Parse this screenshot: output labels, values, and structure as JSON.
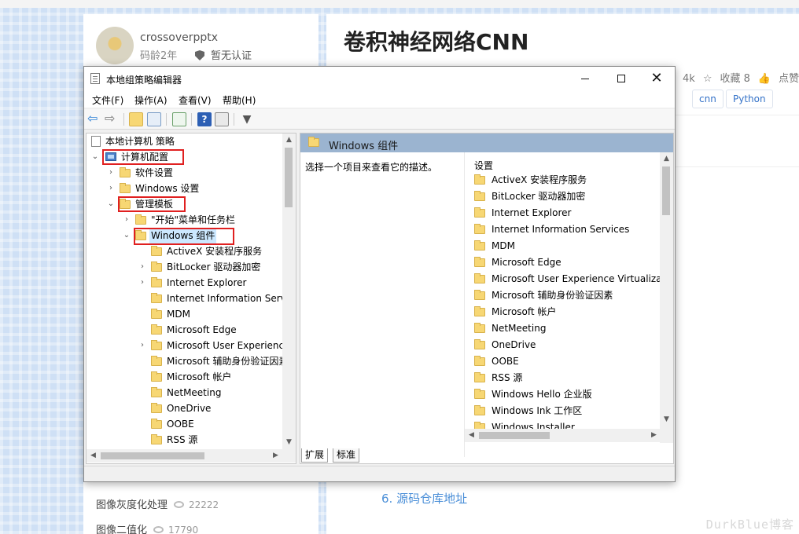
{
  "blog": {
    "author_name": "crossoverpptx",
    "author_age": "码龄2年",
    "author_cert": "暂无认证",
    "article_title": "卷积神经网络CNN",
    "stats": [
      "4k",
      "收藏 8",
      "点赞数"
    ],
    "tags": [
      "cnn",
      "Python"
    ],
    "related": [
      {
        "title": "图像灰度化处理",
        "count": "22222"
      },
      {
        "title": "图像二值化",
        "count": "17790"
      }
    ],
    "toc_link": "6. 源码仓库地址",
    "watermark": "DurkBlue博客"
  },
  "window": {
    "title": "本地组策略编辑器",
    "menu": [
      "文件(F)",
      "操作(A)",
      "查看(V)",
      "帮助(H)"
    ],
    "tree": {
      "root": "本地计算机 策略",
      "computer_config": "计算机配置",
      "software_settings": "软件设置",
      "windows_settings": "Windows 设置",
      "admin_templates": "管理模板",
      "start_menu": "\"开始\"菜单和任务栏",
      "windows_components": "Windows 组件",
      "children": [
        {
          "label": "ActiveX 安装程序服务",
          "expandable": false
        },
        {
          "label": "BitLocker 驱动器加密",
          "expandable": true
        },
        {
          "label": "Internet Explorer",
          "expandable": true
        },
        {
          "label": "Internet Information Servi",
          "expandable": false
        },
        {
          "label": "MDM",
          "expandable": false
        },
        {
          "label": "Microsoft Edge",
          "expandable": false
        },
        {
          "label": "Microsoft User Experience",
          "expandable": true
        },
        {
          "label": "Microsoft 辅助身份验证因素",
          "expandable": false
        },
        {
          "label": "Microsoft 帐户",
          "expandable": false
        },
        {
          "label": "NetMeeting",
          "expandable": false
        },
        {
          "label": "OneDrive",
          "expandable": false
        },
        {
          "label": "OOBE",
          "expandable": false
        },
        {
          "label": "RSS 源",
          "expandable": false
        }
      ]
    },
    "right_pane": {
      "header": "Windows 组件",
      "description": "选择一个项目来查看它的描述。",
      "column_header": "设置",
      "items": [
        "ActiveX 安装程序服务",
        "BitLocker 驱动器加密",
        "Internet Explorer",
        "Internet Information Services",
        "MDM",
        "Microsoft Edge",
        "Microsoft User Experience Virtualizatic",
        "Microsoft 辅助身份验证因素",
        "Microsoft 帐户",
        "NetMeeting",
        "OneDrive",
        "OOBE",
        "RSS 源",
        "Windows Hello 企业版",
        "Windows Ink 工作区",
        "Windows Installer"
      ]
    },
    "tabs": [
      "扩展",
      "标准"
    ]
  }
}
